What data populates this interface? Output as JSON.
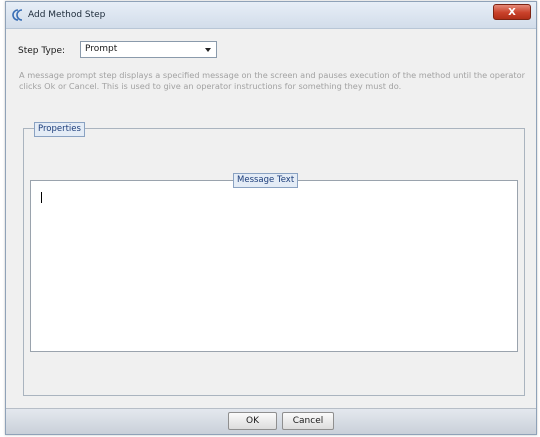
{
  "window": {
    "title": "Add Method Step",
    "close_label": "X"
  },
  "step_type": {
    "label": "Step Type:",
    "selected": "Prompt"
  },
  "description": "A message prompt step displays a specified message on the screen and pauses execution of the method until the operator clicks Ok or Cancel. This is used to give an operator instructions for something they must do.",
  "properties": {
    "label": "Properties",
    "message_text": {
      "label": "Message Text",
      "value": ""
    }
  },
  "buttons": {
    "ok": "OK",
    "cancel": "Cancel"
  },
  "colors": {
    "group_label_bg": "#e4ecf6",
    "group_label_text": "#1c3d7a",
    "close_button": "#c9412a"
  },
  "icons": {
    "app": "app-logo-icon",
    "dropdown": "chevron-down-icon"
  }
}
